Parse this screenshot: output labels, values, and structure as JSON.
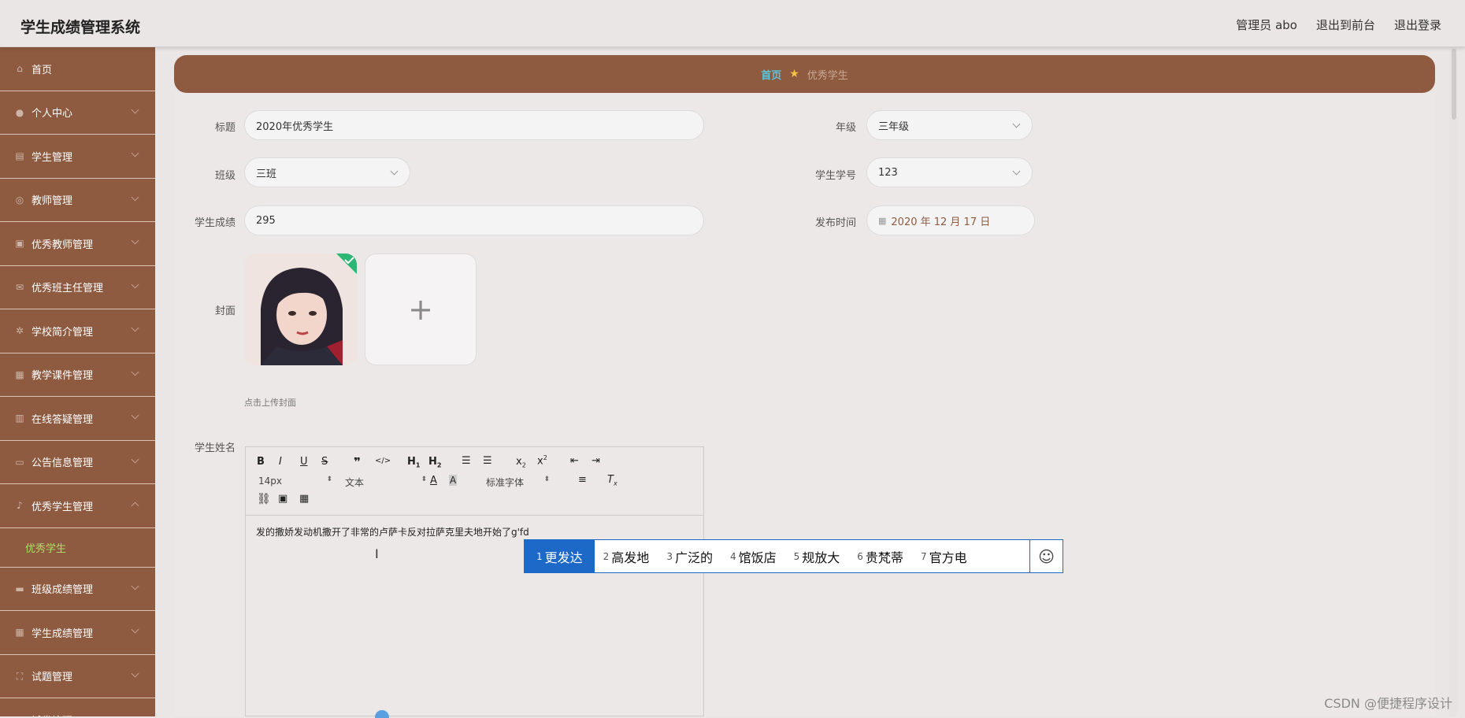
{
  "app": {
    "title": "学生成绩管理系统"
  },
  "header": {
    "user": "管理员 abo",
    "to_front": "退出到前台",
    "logout": "退出登录"
  },
  "sidebar": {
    "items": [
      {
        "label": "首页",
        "icon": "home-icon",
        "glyph": "⌂",
        "expandable": false
      },
      {
        "label": "个人中心",
        "icon": "user-icon",
        "glyph": "●",
        "expandable": true
      },
      {
        "label": "学生管理",
        "icon": "table-icon",
        "glyph": "▤",
        "expandable": true
      },
      {
        "label": "教师管理",
        "icon": "teacher-icon",
        "glyph": "◎",
        "expandable": true
      },
      {
        "label": "优秀教师管理",
        "icon": "clipboard-icon",
        "glyph": "▣",
        "expandable": true
      },
      {
        "label": "优秀班主任管理",
        "icon": "mail-icon",
        "glyph": "✉",
        "expandable": true
      },
      {
        "label": "学校简介管理",
        "icon": "compass-icon",
        "glyph": "✲",
        "expandable": true
      },
      {
        "label": "教学课件管理",
        "icon": "grid-icon",
        "glyph": "▦",
        "expandable": true
      },
      {
        "label": "在线答疑管理",
        "icon": "bar-chart-icon",
        "glyph": "▥",
        "expandable": true
      },
      {
        "label": "公告信息管理",
        "icon": "monitor-icon",
        "glyph": "▭",
        "expandable": true
      },
      {
        "label": "优秀学生管理",
        "icon": "mic-icon",
        "glyph": "♪",
        "expandable": true,
        "expanded": true
      },
      {
        "label": "班级成绩管理",
        "icon": "briefcase-icon",
        "glyph": "▬",
        "expandable": true
      },
      {
        "label": "学生成绩管理",
        "icon": "grid-small-icon",
        "glyph": "▦",
        "expandable": true
      },
      {
        "label": "试题管理",
        "icon": "fullscreen-icon",
        "glyph": "⛶",
        "expandable": true
      }
    ],
    "sub_item": "优秀学生",
    "partial_item": "试卷管理"
  },
  "breadcrumb": {
    "home": "首页",
    "current": "优秀学生"
  },
  "form": {
    "title_label": "标题",
    "title_value": "2020年优秀学生",
    "grade_label": "年级",
    "grade_value": "三年级",
    "class_label": "班级",
    "class_value": "三班",
    "student_no_label": "学生学号",
    "student_no_value": "123",
    "score_label": "学生成绩",
    "score_value": "295",
    "publish_label": "发布时间",
    "publish_value": "2020 年 12 月 17 日",
    "cover_label": "封面",
    "upload_hint": "点击上传封面",
    "name_label": "学生姓名"
  },
  "editor": {
    "font_size": "14px",
    "block_type": "文本",
    "font_family": "标准字体",
    "content": "发的撒娇发动机撒开了非常的卢萨卡反对拉萨克里夫地开始了g'fd"
  },
  "ime": {
    "candidates": [
      {
        "n": "1",
        "text": "更发达"
      },
      {
        "n": "2",
        "text": "高发地"
      },
      {
        "n": "3",
        "text": "广泛的"
      },
      {
        "n": "4",
        "text": "馆饭店"
      },
      {
        "n": "5",
        "text": "规放大"
      },
      {
        "n": "6",
        "text": "贵梵蒂"
      },
      {
        "n": "7",
        "text": "官方电"
      }
    ]
  },
  "watermark": "CSDN @便捷程序设计",
  "colors": {
    "sidebar": "#8e5a40",
    "accent_active": "#a8e063",
    "ime_blue": "#1d69c8"
  }
}
